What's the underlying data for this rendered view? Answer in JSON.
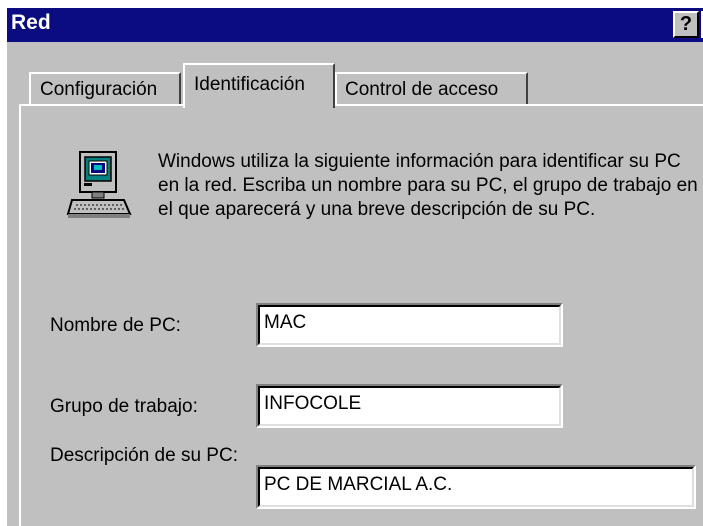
{
  "window": {
    "title": "Red",
    "help_glyph": "?"
  },
  "tabs": [
    {
      "label": "Configuración",
      "active": false
    },
    {
      "label": "Identificación",
      "active": true
    },
    {
      "label": "Control de acceso",
      "active": false
    }
  ],
  "info_icon": "computer-icon",
  "description": "Windows utiliza la siguiente información para identificar su PC en la red. Escriba un nombre para su PC, el grupo de trabajo en el que aparecerá y una breve descripción de su PC.",
  "form": {
    "pc_name": {
      "label": "Nombre de PC:",
      "value": "MAC"
    },
    "workgroup": {
      "label": "Grupo de trabajo:",
      "value": "INFOCOLE"
    },
    "pc_description": {
      "label": "Descripción de su PC:",
      "value": "PC DE MARCIAL A.C."
    }
  },
  "colors": {
    "title_bar": "#0b0c7f",
    "face": "#c0c0c0",
    "field_bg": "#ffffff"
  }
}
